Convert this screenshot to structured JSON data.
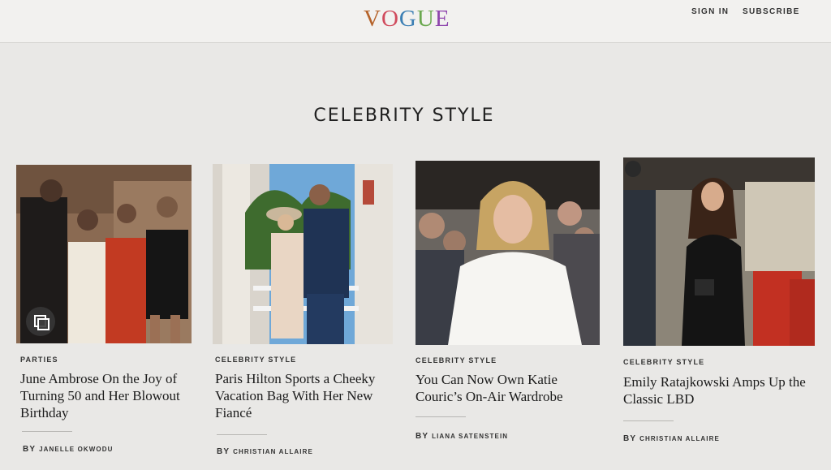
{
  "header": {
    "logo": "VOGUE",
    "logo_colors": [
      "#b5632a",
      "#d04a5c",
      "#3c7fb4",
      "#6aa84f",
      "#8e44ad"
    ],
    "sign_in": "SIGN IN",
    "subscribe": "SUBSCRIBE"
  },
  "section": {
    "title": "CELEBRITY STYLE"
  },
  "articles": [
    {
      "category": "PARTIES",
      "headline": "June Ambrose On the Joy of Turning 50 and Her Blowout Birthday",
      "by": "BY",
      "author": "JANELLE OKWODU",
      "icon": "gallery-icon"
    },
    {
      "category": "CELEBRITY STYLE",
      "headline": "Paris Hilton Sports a Cheeky Vacation Bag With Her New Fiancé",
      "by": "BY",
      "author": "CHRISTIAN ALLAIRE"
    },
    {
      "category": "CELEBRITY STYLE",
      "headline": "You Can Now Own Katie Couric’s On-Air Wardrobe",
      "by": "BY",
      "author": "LIANA SATENSTEIN"
    },
    {
      "category": "CELEBRITY STYLE",
      "headline": "Emily Ratajkowski Amps Up the Classic LBD",
      "by": "BY",
      "author": "CHRISTIAN ALLAIRE"
    }
  ],
  "colors": {
    "category_text": "#333333",
    "page_bg": "#e9e8e6"
  }
}
